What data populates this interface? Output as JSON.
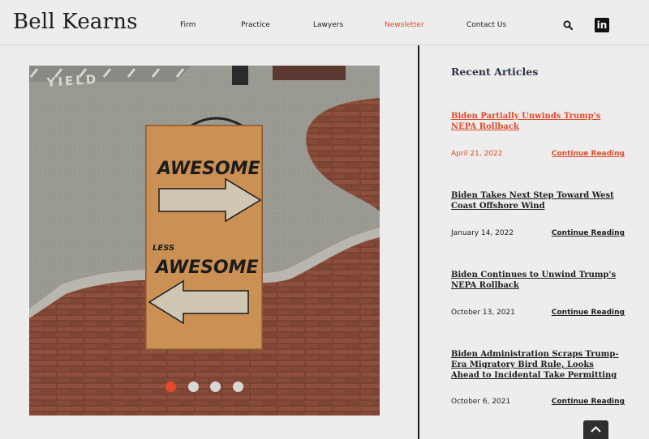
{
  "header": {
    "logo": "Bell Kearns",
    "nav": [
      {
        "label": "Firm",
        "active": false
      },
      {
        "label": "Practice",
        "active": false
      },
      {
        "label": "Lawyers",
        "active": false
      },
      {
        "label": "Newsletter",
        "active": true
      },
      {
        "label": "Contact Us",
        "active": false
      }
    ],
    "search_icon": "search-icon",
    "social_icon": "linkedin-icon",
    "social_label": "in"
  },
  "hero": {
    "sign_top": "AWESOME",
    "sign_less": "LESS",
    "sign_bottom": "AWESOME",
    "road_text": "YIELD",
    "slide_count": 4,
    "active_slide": 1
  },
  "sidebar": {
    "title": "Recent Articles",
    "articles": [
      {
        "title": "Biden Partially Unwinds Trump's NEPA Rollback",
        "date": "April 21, 2022",
        "more": "Continue Reading",
        "highlight": true
      },
      {
        "title": "Biden Takes Next Step Toward West Coast Offshore Wind",
        "date": "January 14, 2022",
        "more": "Continue Reading",
        "highlight": false
      },
      {
        "title": "Biden Continues to Unwind Trump's NEPA Rollback",
        "date": "October 13, 2021",
        "more": "Continue Reading",
        "highlight": false
      },
      {
        "title": "Biden Administration Scraps Trump-Era Migratory Bird Rule, Looks Ahead to Incidental Take Permitting",
        "date": "October 6, 2021",
        "more": "Continue Reading",
        "highlight": false
      }
    ]
  },
  "colors": {
    "accent": "#e24a28",
    "text": "#1d1d1d",
    "background": "#ededed"
  },
  "scroll_top_icon": "chevron-up-icon"
}
